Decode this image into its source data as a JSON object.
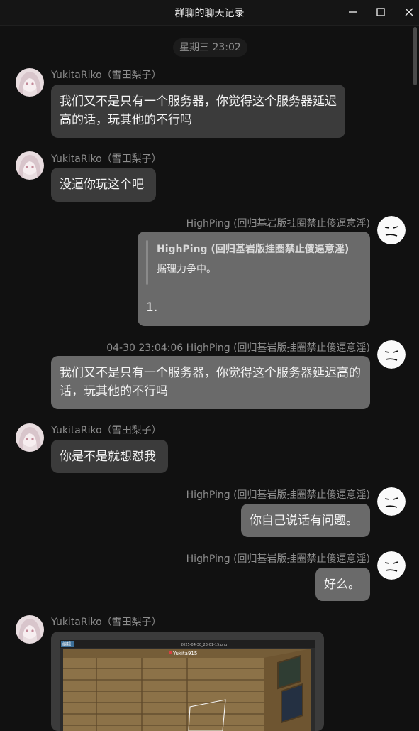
{
  "window": {
    "title": "群聊的聊天记录"
  },
  "timestamp_divider": "星期三 23:02",
  "users": {
    "riko": "YukitaRiko（雪田梨子）",
    "high": "HighPing (回归基岩版挂圈禁止傻逼意淫)",
    "high_timed": "04-30 23:04:06 HighPing (回归基岩版挂圈禁止傻逼意淫)"
  },
  "messages": [
    {
      "text": "我们又不是只有一个服务器，你觉得这个服务器延迟高的话，玩其他的不行吗"
    },
    {
      "text": "没逼你玩这个吧"
    },
    {
      "quote_author": "HighPing (回归基岩版挂圈禁止傻逼意淫)",
      "quote_text": "据理力争中。",
      "text": "1."
    },
    {
      "text": "我们又不是只有一个服务器，你觉得这个服务器延迟高的话，玩其他的不行吗"
    },
    {
      "text": "你是不是就想怼我"
    },
    {
      "text": "你自己说话有问题。"
    },
    {
      "text": "好么。"
    }
  ],
  "image_message": {
    "toolbar_label": "编辑",
    "file_name": "2025-04-30_23-01-15.png",
    "player_tag": "Yukita915"
  }
}
